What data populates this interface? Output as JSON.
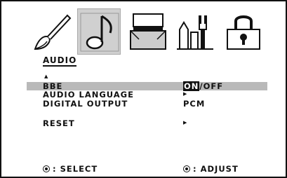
{
  "section_title": "AUDIO",
  "tabs": [
    {
      "icon": "brush-icon",
      "selected": false
    },
    {
      "icon": "music-note-icon",
      "selected": true
    },
    {
      "icon": "box-icon",
      "selected": false
    },
    {
      "icon": "tools-icon",
      "selected": false
    },
    {
      "icon": "lock-icon",
      "selected": false
    }
  ],
  "scroll_up_glyph": "▲",
  "rows": {
    "bbe": {
      "label": "BBE",
      "on": "ON",
      "sep": "/",
      "off": "OFF"
    },
    "audio_language": {
      "label": "AUDIO LANGUAGE",
      "value": "▶"
    },
    "digital_output": {
      "label": "DIGITAL OUTPUT",
      "value": "PCM"
    },
    "reset": {
      "label": "RESET",
      "value": "▶"
    }
  },
  "footer": {
    "select": ": SELECT",
    "adjust": ": ADJUST"
  }
}
